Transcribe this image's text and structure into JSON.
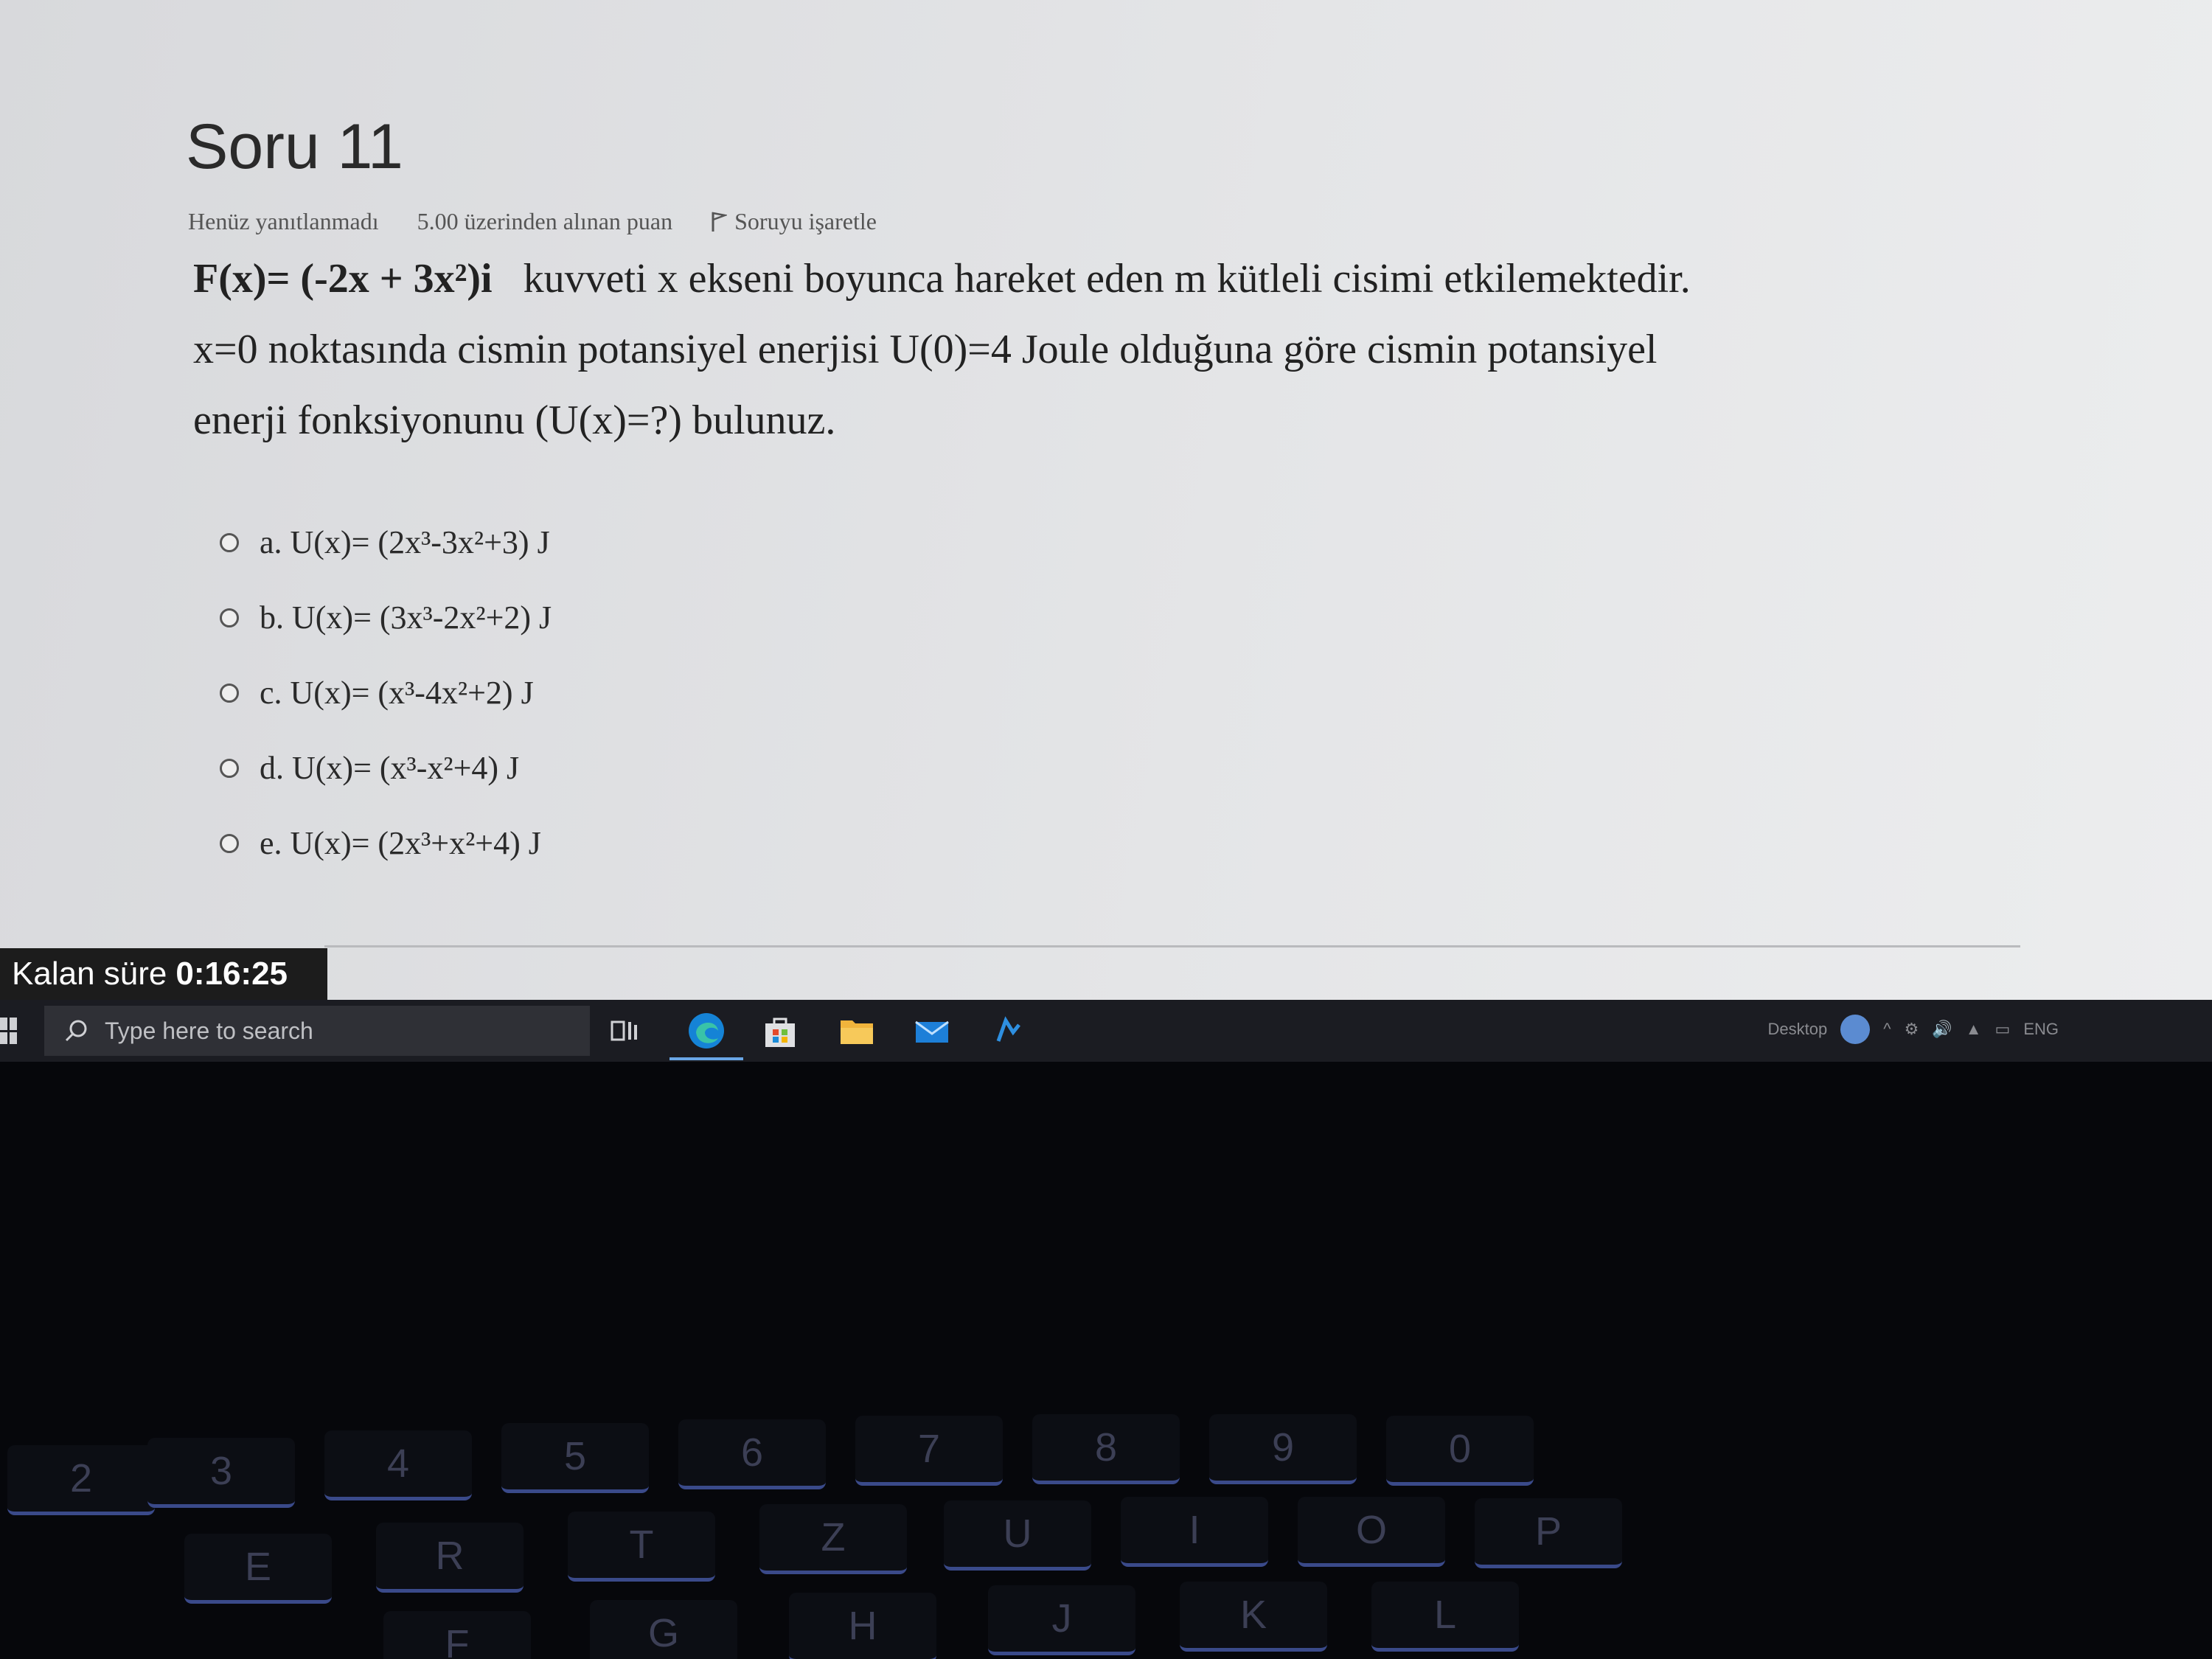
{
  "question": {
    "title": "Soru 11",
    "status": "Henüz yanıtlanmadı",
    "points": "5.00 üzerinden alınan puan",
    "flag_label": "Soruyu işaretle",
    "formula": "F(x)= (-2x + 3x²)i",
    "line1_rest": "kuvveti  x  ekseni boyunca hareket eden  m   kütleli cisimi etkilemektedir.",
    "line2": "x=0 noktasında cismin potansiyel enerjisi  U(0)=4 Joule  olduğuna göre cismin potansiyel",
    "line3": "enerji fonksiyonunu (U(x)=?) bulunuz."
  },
  "options": [
    {
      "label": "a. U(x)= (2x³-3x²+3) J"
    },
    {
      "label": "b. U(x)= (3x³-2x²+2) J"
    },
    {
      "label": "c. U(x)= (x³-4x²+2) J"
    },
    {
      "label": "d. U(x)= (x³-x²+4) J"
    },
    {
      "label": "e. U(x)= (2x³+x²+4) J"
    }
  ],
  "timer": {
    "label": "Kalan süre",
    "value": "0:16:25"
  },
  "taskbar": {
    "search_placeholder": "Type here to search",
    "desktop_label": "Desktop",
    "lang": "ENG",
    "icons": [
      "task-view-icon",
      "edge-icon",
      "store-icon",
      "file-explorer-icon",
      "mail-icon",
      "app-icon"
    ]
  },
  "keyboard": {
    "keys": [
      "2",
      "3",
      "4",
      "5",
      "6",
      "7",
      "8",
      "9",
      "0",
      "E",
      "R",
      "T",
      "Z",
      "U",
      "I",
      "O",
      "P",
      "F",
      "G",
      "H",
      "J",
      "K",
      "L"
    ]
  }
}
